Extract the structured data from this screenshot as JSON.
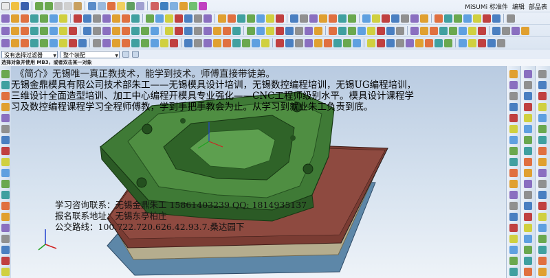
{
  "menubar": {
    "right_items": [
      "MiSUMi 标准件",
      "编辑",
      "部品表"
    ]
  },
  "filter_bar": {
    "type_filter": "没有选择过滤器",
    "assembly_scope": "整个装配"
  },
  "status_prompt": "选择对象并使用 MB3，或者双击某一对象",
  "overlay": {
    "intro": "《简介》无锡唯一真正教技术，能学到技术。师傅直接带徒弟。",
    "lines": [
      "无锡金鼎模具有限公司技术部朱工——无锡模具设计培训，无锡数控编程培训，无锡UG编程培训，",
      "三维设计全面造型培训、加工中心编程开模具专业强化——CNC工程师级别水平。模具设计课程学",
      "习及数控编程课程学习全程师傅教，学到手把手教会为止。从学习到就业朱工负责到底。"
    ],
    "contact": {
      "line1": "学习咨询联系：无锡金鼎朱工 15861403239 QQ: 1814935137",
      "line2": "报名联系地址：无锡东亭柏庄",
      "line3": "公交路线：100.722.720.626.42.93.7.桑达园下"
    }
  },
  "colors": {
    "mold_green": "#3f7a36",
    "mold_dark": "#24501f",
    "plate_red": "#7a3c33",
    "plate_tan": "#b5ad8e",
    "plate_blue": "#5d87a8",
    "viewport_top": "#b9cbe1"
  },
  "icons": {
    "toolbars": "ug-toolbar-icons",
    "axes": "wcs-triad-icon",
    "resource_bar": "resource-bar-icons"
  }
}
